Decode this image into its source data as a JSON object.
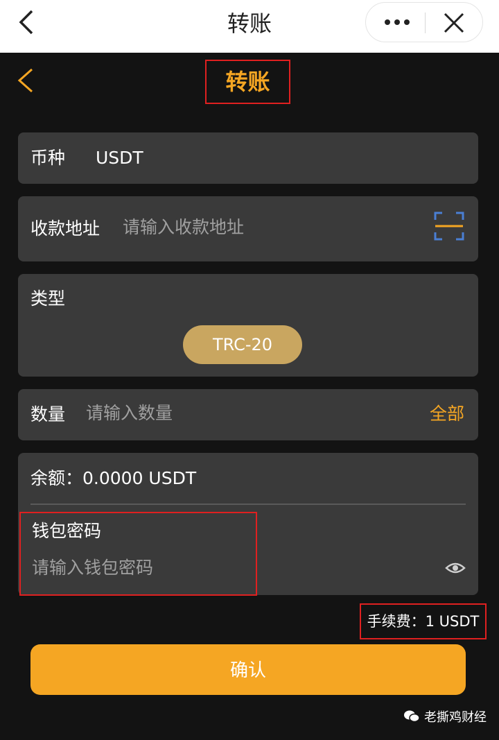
{
  "topbar": {
    "title": "转账",
    "back_icon": "chevron-left-icon",
    "more_icon": "more-dots-icon",
    "close_icon": "close-icon"
  },
  "header": {
    "title": "转账",
    "back_icon": "chevron-left-icon"
  },
  "currency": {
    "label": "币种",
    "value": "USDT"
  },
  "address": {
    "label": "收款地址",
    "placeholder": "请输入收款地址",
    "scan_icon": "scan-icon"
  },
  "type": {
    "label": "类型",
    "selected": "TRC-20"
  },
  "amount": {
    "label": "数量",
    "placeholder": "请输入数量",
    "all_label": "全部"
  },
  "balance": {
    "text": "余额：0.0000 USDT"
  },
  "password": {
    "label": "钱包密码",
    "placeholder": "请输入钱包密码",
    "eye_icon": "eye-icon"
  },
  "fee": {
    "text": "手续费：1 USDT"
  },
  "confirm": {
    "label": "确认"
  },
  "footer_tag": {
    "text": "老撕鸡财经",
    "icon": "wechat-icon"
  },
  "colors": {
    "accent": "#f5a623",
    "highlight_border": "#e02020",
    "card_bg": "#3a3a3a",
    "chip_bg": "#c9a660"
  }
}
